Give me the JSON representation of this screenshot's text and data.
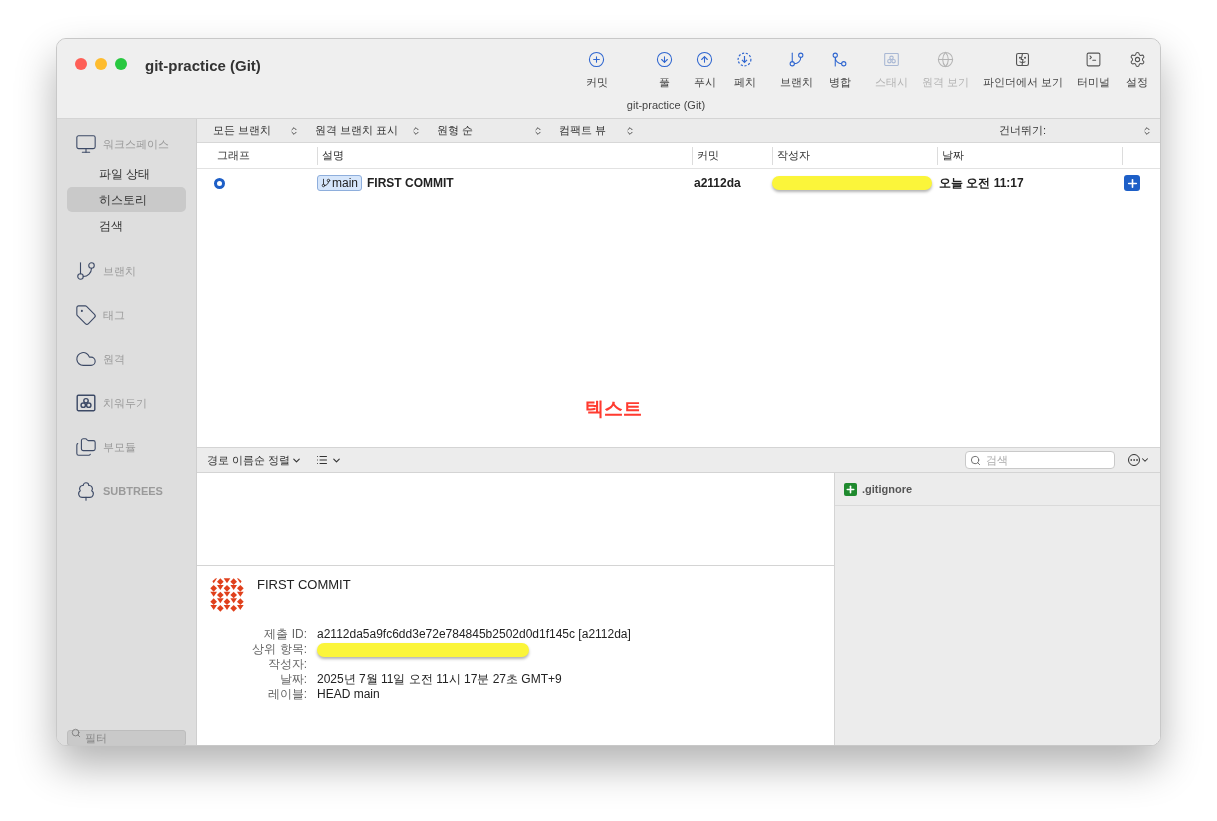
{
  "window": {
    "title": "git-practice (Git)",
    "subtitle": "git-practice (Git)"
  },
  "toolbar": [
    {
      "label": "커밋",
      "kind": "commit",
      "disabled": false
    },
    {
      "label": "풀",
      "kind": "pull",
      "disabled": false
    },
    {
      "label": "푸시",
      "kind": "push",
      "disabled": false
    },
    {
      "label": "페치",
      "kind": "fetch",
      "disabled": false
    },
    {
      "label": "브랜치",
      "kind": "branch",
      "disabled": false
    },
    {
      "label": "병합",
      "kind": "merge",
      "disabled": false
    },
    {
      "label": "스태시",
      "kind": "stash",
      "disabled": true
    },
    {
      "label": "원격 보기",
      "kind": "remote",
      "disabled": true
    },
    {
      "label": "파인더에서 보기",
      "kind": "finder",
      "disabled": false
    },
    {
      "label": "터미널",
      "kind": "terminal",
      "disabled": false
    },
    {
      "label": "설정",
      "kind": "settings",
      "disabled": false
    }
  ],
  "sidebar": {
    "sections": [
      {
        "label": "워크스페이스",
        "kind": "workspace",
        "children": [
          {
            "label": "파일 상태",
            "selected": false
          },
          {
            "label": "히스토리",
            "selected": true
          },
          {
            "label": "검색",
            "selected": false
          }
        ]
      },
      {
        "label": "브랜치",
        "kind": "branch"
      },
      {
        "label": "태그",
        "kind": "tag"
      },
      {
        "label": "원격",
        "kind": "cloud"
      },
      {
        "label": "치워두기",
        "kind": "stash"
      },
      {
        "label": "부모듈",
        "kind": "folders"
      },
      {
        "label": "SUBTREES",
        "kind": "trees"
      }
    ],
    "filter": {
      "placeholder": "필터"
    }
  },
  "filters": [
    {
      "label": "모든 브랜치"
    },
    {
      "label": "원격 브랜치 표시"
    },
    {
      "label": "원형 순"
    },
    {
      "label": "컴팩트 뷰"
    }
  ],
  "jump": {
    "label": "건너뛰기:"
  },
  "table": {
    "columns": [
      "그래프",
      "설명",
      "커밋",
      "작성자",
      "날짜"
    ],
    "rows": [
      {
        "selected": false,
        "branch": "main",
        "description": "FIRST COMMIT",
        "commit": "a2112da",
        "author": {
          "redacted": true
        },
        "date": "오늘 오전 11:17"
      }
    ]
  },
  "annotation": {
    "text": "텍스트"
  },
  "file_toolbar": {
    "sort": "경로 이름순 정렬",
    "search": {
      "placeholder": "검색"
    }
  },
  "files": [
    {
      "name": ".gitignore",
      "kind": "added"
    }
  ],
  "commit_detail": {
    "title": "FIRST COMMIT",
    "fields": [
      {
        "label": "제출 ID:",
        "value": "a2112da5a9fc6dd3e72e784845b2502d0d1f145c [a2112da]"
      },
      {
        "label": "상위 항목:",
        "redacted": true
      },
      {
        "label": "작성자:"
      },
      {
        "label": "날짜:",
        "value": "2025년 7월 11일 오전 11시 17분 27초 GMT+9"
      },
      {
        "label": "레이블:",
        "value": "HEAD main"
      }
    ]
  }
}
